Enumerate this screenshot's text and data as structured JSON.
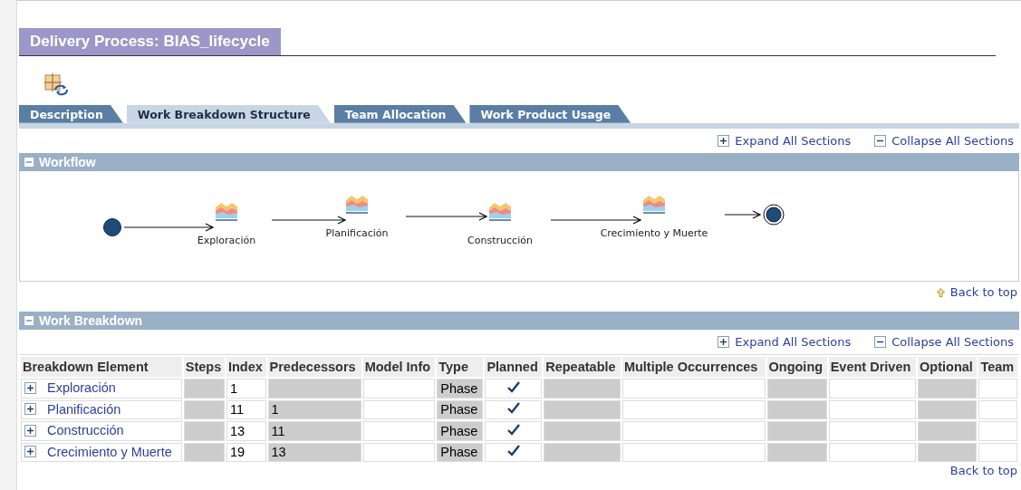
{
  "title": "Delivery Process: BIAS_lifecycle",
  "tabs": [
    {
      "label": "Description",
      "selected": false
    },
    {
      "label": "Work Breakdown Structure",
      "selected": true
    },
    {
      "label": "Team Allocation",
      "selected": false
    },
    {
      "label": "Work Product Usage",
      "selected": false
    }
  ],
  "section_links": [
    "Expand All Sections",
    "Collapse All Sections"
  ],
  "workflow": {
    "title": "Workflow",
    "expanded": true,
    "nodes": [
      {
        "kind": "start"
      },
      {
        "kind": "phase",
        "label": "Exploración"
      },
      {
        "kind": "phase",
        "label": "Planificación"
      },
      {
        "kind": "phase",
        "label": "Construcción"
      },
      {
        "kind": "phase",
        "label": "Crecimiento y Muerte"
      },
      {
        "kind": "end"
      }
    ]
  },
  "back_to_top": "Back to top",
  "work_breakdown": {
    "title": "Work Breakdown",
    "expanded": true,
    "links": [
      "Expand All Sections",
      "Collapse All Sections"
    ],
    "columns": [
      {
        "label": "Breakdown Element",
        "shaded": false
      },
      {
        "label": "Steps",
        "shaded": true
      },
      {
        "label": "Index",
        "shaded": false
      },
      {
        "label": "Predecessors",
        "shaded": true
      },
      {
        "label": "Model Info",
        "shaded": false
      },
      {
        "label": "Type",
        "shaded": true
      },
      {
        "label": "Planned",
        "shaded": false
      },
      {
        "label": "Repeatable",
        "shaded": true
      },
      {
        "label": "Multiple Occurrences",
        "shaded": false
      },
      {
        "label": "Ongoing",
        "shaded": true
      },
      {
        "label": "Event Driven",
        "shaded": false
      },
      {
        "label": "Optional",
        "shaded": true
      },
      {
        "label": "Team",
        "shaded": false
      }
    ],
    "rows": [
      {
        "element": "Exploración",
        "index": "1",
        "predecessors": "",
        "type": "Phase",
        "planned": true
      },
      {
        "element": "Planificación",
        "index": "11",
        "predecessors": "1",
        "type": "Phase",
        "planned": true
      },
      {
        "element": "Construcción",
        "index": "13",
        "predecessors": "11",
        "type": "Phase",
        "planned": true
      },
      {
        "element": "Crecimiento y Muerte",
        "index": "19",
        "predecessors": "13",
        "type": "Phase",
        "planned": true
      }
    ]
  },
  "back_to_top_bottom": "Back to top"
}
